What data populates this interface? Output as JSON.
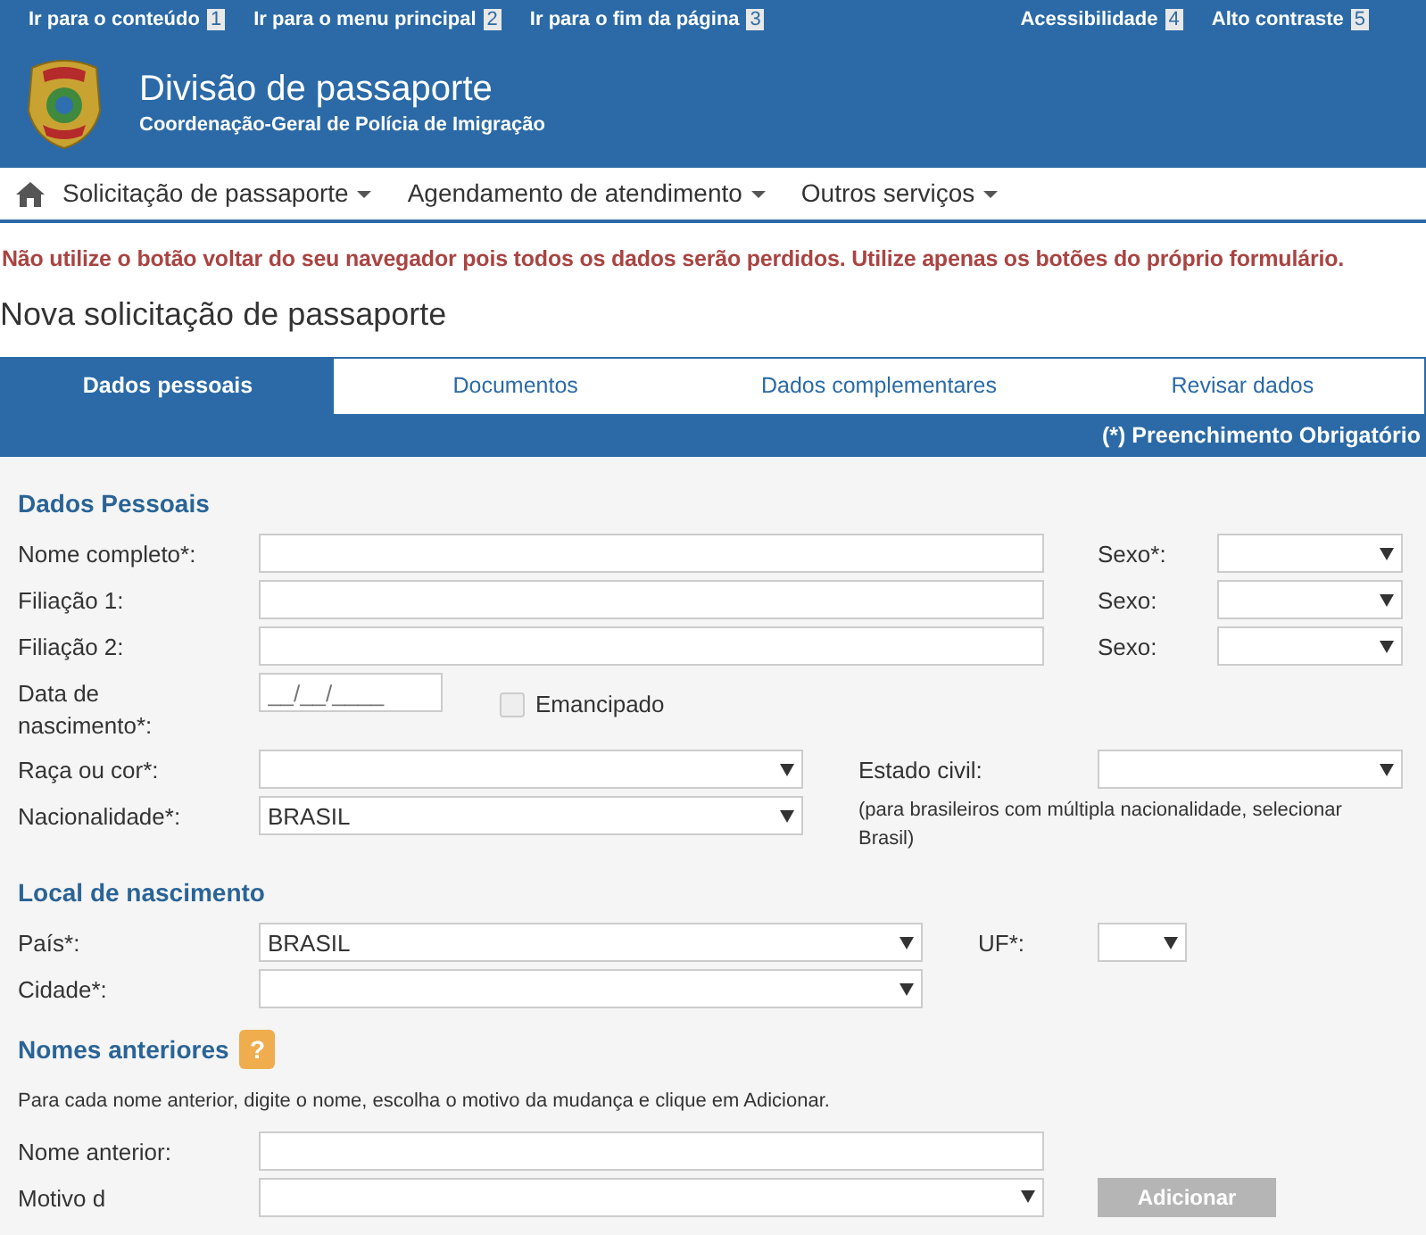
{
  "skip_links": [
    {
      "label": "Ir para o conteúdo",
      "key": "1"
    },
    {
      "label": "Ir para o menu principal",
      "key": "2"
    },
    {
      "label": "Ir para o fim da página",
      "key": "3"
    }
  ],
  "access_links": [
    {
      "label": "Acessibilidade",
      "key": "4"
    },
    {
      "label": "Alto contraste",
      "key": "5"
    }
  ],
  "header": {
    "title": "Divisão de passaporte",
    "subtitle": "Coordenação-Geral de Polícia de Imigração"
  },
  "nav": [
    {
      "label": "Solicitação de passaporte"
    },
    {
      "label": "Agendamento de atendimento"
    },
    {
      "label": "Outros serviços"
    }
  ],
  "warning": "Não utilize o botão voltar do seu navegador pois todos os dados serão perdidos. Utilize apenas os botões do próprio formulário.",
  "page_title": "Nova solicitação de passaporte",
  "tabs": [
    {
      "label": "Dados pessoais",
      "selected": true
    },
    {
      "label": "Documentos",
      "selected": false
    },
    {
      "label": "Dados complementares",
      "selected": false
    },
    {
      "label": "Revisar dados",
      "selected": false
    }
  ],
  "required_note": "(*) Preenchimento Obrigatório",
  "sections": [
    {
      "title": "Dados Pessoais",
      "rows": [
        {
          "kind": "text-side",
          "label": "Nome completo*:",
          "value": "",
          "side_label": "Sexo*:",
          "side_value": ""
        },
        {
          "kind": "text-side",
          "label": "Filiação 1:",
          "value": "",
          "side_label": "Sexo:",
          "side_value": ""
        },
        {
          "kind": "text-side",
          "label": "Filiação 2:",
          "value": "",
          "side_label": "Sexo:",
          "side_value": ""
        },
        {
          "kind": "date",
          "label": "Data de nascimento*:",
          "placeholder": "__/__/____",
          "check_label": "Emancipado",
          "checked": false
        },
        {
          "kind": "select-side",
          "label": "Raça ou cor*:",
          "value": "",
          "side_label": "Estado civil:",
          "side_value": ""
        },
        {
          "kind": "select-note",
          "label": "Nacionalidade*:",
          "value": "BRASIL",
          "note": "(para brasileiros com múltipla nacionalidade, selecionar Brasil)"
        }
      ]
    },
    {
      "title": "Local de nascimento",
      "rows": [
        {
          "kind": "select-small",
          "label": "País*:",
          "value": "BRASIL",
          "side_label": "UF*:",
          "side_value": ""
        },
        {
          "kind": "select",
          "label": "Cidade*:",
          "value": ""
        }
      ]
    },
    {
      "title": "Nomes anteriores",
      "help": "?",
      "instructions": "Para cada nome anterior, digite o nome, escolha o motivo da mudança e clique em Adicionar.",
      "rows": [
        {
          "kind": "text",
          "label": "Nome anterior:",
          "value": ""
        },
        {
          "kind": "select-button",
          "label": "Motivo d",
          "value": "",
          "button": "Adicionar",
          "disabled": true
        }
      ]
    }
  ]
}
